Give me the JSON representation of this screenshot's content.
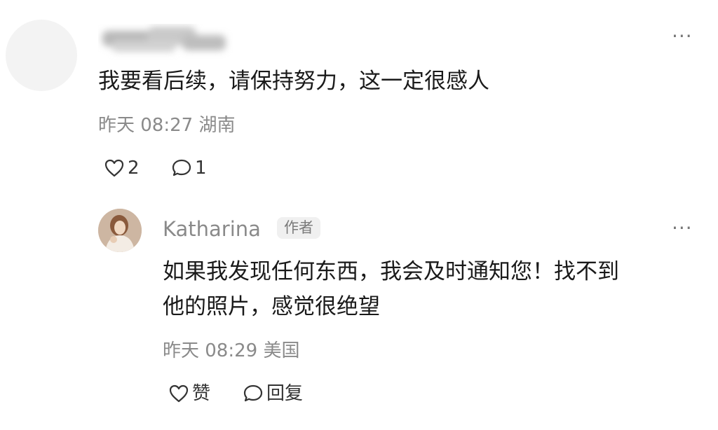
{
  "comment": {
    "text": "我要看后续，请保持努力，这一定很感人",
    "time": "昨天 08:27",
    "location": "湖南",
    "like_count": "2",
    "reply_count": "1",
    "more_icon": "more-horizontal-icon"
  },
  "reply": {
    "author": "Katharina",
    "author_badge": "作者",
    "text_line1": "如果我发现任何东西，我会及时通知您！找不到",
    "text_line2": "他的照片，感觉很绝望",
    "time": "昨天 08:29",
    "location": "美国",
    "like_label": "赞",
    "reply_label": "回复",
    "more_icon": "more-horizontal-icon"
  }
}
